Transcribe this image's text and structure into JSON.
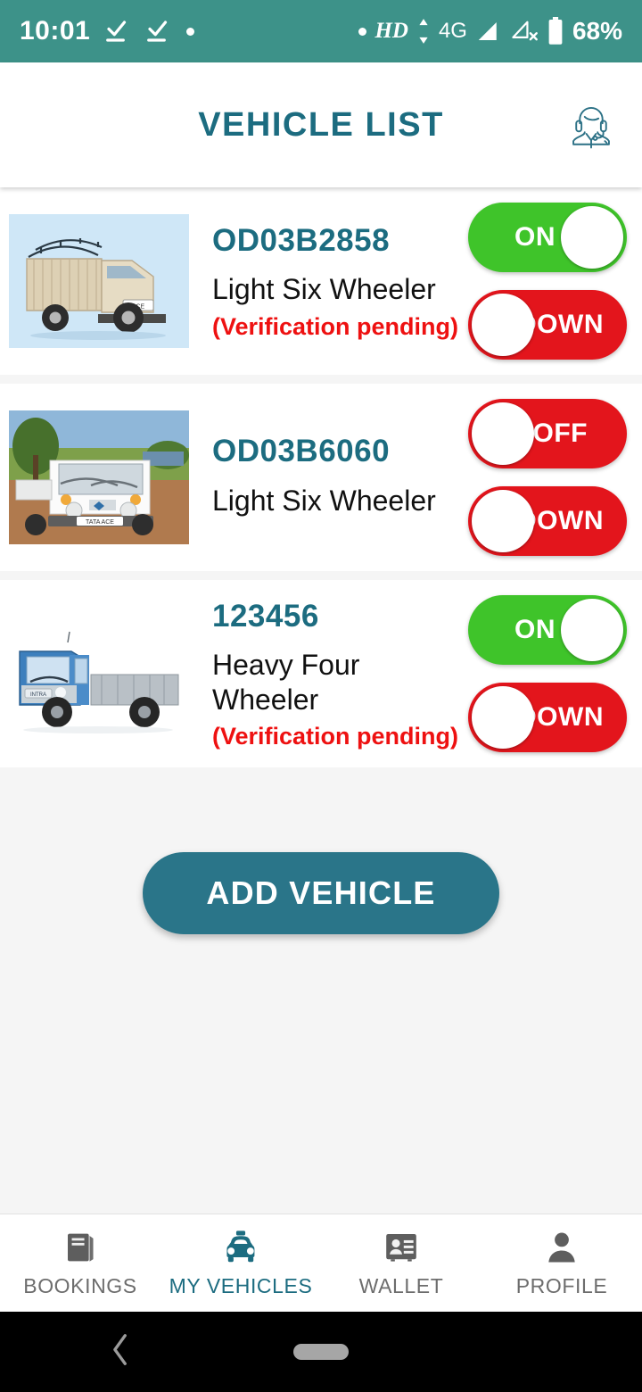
{
  "status_bar": {
    "time": "10:01",
    "hd_label": "HD",
    "network": "4G",
    "battery_percent": "68%",
    "icons": [
      "check-download-icon",
      "check-download-icon",
      "dot-icon",
      "dot-icon",
      "hd-icon",
      "updown-arrow-icon",
      "signal-bars-icon",
      "signal-off-icon",
      "battery-icon"
    ],
    "background_color": "#3d9289"
  },
  "header": {
    "title": "VEHICLE LIST",
    "support_icon": "support-agent-icon",
    "title_color": "#1c6c80"
  },
  "vehicles": [
    {
      "plate": "OD03B2858",
      "type": "Light Six Wheeler",
      "status_note": "(Verification pending)",
      "image": "beige-tata-ace-canopy-truck",
      "power_toggle": {
        "label": "ON",
        "state": "on"
      },
      "down_toggle": {
        "label": "DOWN",
        "state": "off"
      }
    },
    {
      "plate": "OD03B6060",
      "type": "Light Six Wheeler",
      "status_note": "",
      "image": "white-tata-ace-front-truck",
      "power_toggle": {
        "label": "OFF",
        "state": "off"
      },
      "down_toggle": {
        "label": "DOWN",
        "state": "off"
      }
    },
    {
      "plate": "123456",
      "type": "Heavy Four Wheeler",
      "status_note": "(Verification pending)",
      "image": "blue-tata-intra-truck",
      "power_toggle": {
        "label": "ON",
        "state": "on"
      },
      "down_toggle": {
        "label": "DOWN",
        "state": "off"
      }
    }
  ],
  "add_button": {
    "label": "ADD VEHICLE",
    "color": "#2a7589"
  },
  "bottom_nav": {
    "items": [
      {
        "label": "BOOKINGS",
        "icon": "book-icon",
        "active": false
      },
      {
        "label": "MY VEHICLES",
        "icon": "taxi-car-icon",
        "active": true
      },
      {
        "label": "WALLET",
        "icon": "id-card-icon",
        "active": false
      },
      {
        "label": "PROFILE",
        "icon": "person-icon",
        "active": false
      }
    ],
    "active_color": "#1c6c80",
    "inactive_color": "#6d6d6d"
  },
  "android_nav": {
    "back_icon": "back-chevron-icon",
    "home_icon": "home-pill-icon"
  },
  "colors": {
    "accent_teal": "#1c6c80",
    "toggle_on_green": "#3fc42a",
    "toggle_off_red": "#e3151c",
    "pending_red": "#ee1111",
    "page_bg": "#f5f5f5"
  }
}
